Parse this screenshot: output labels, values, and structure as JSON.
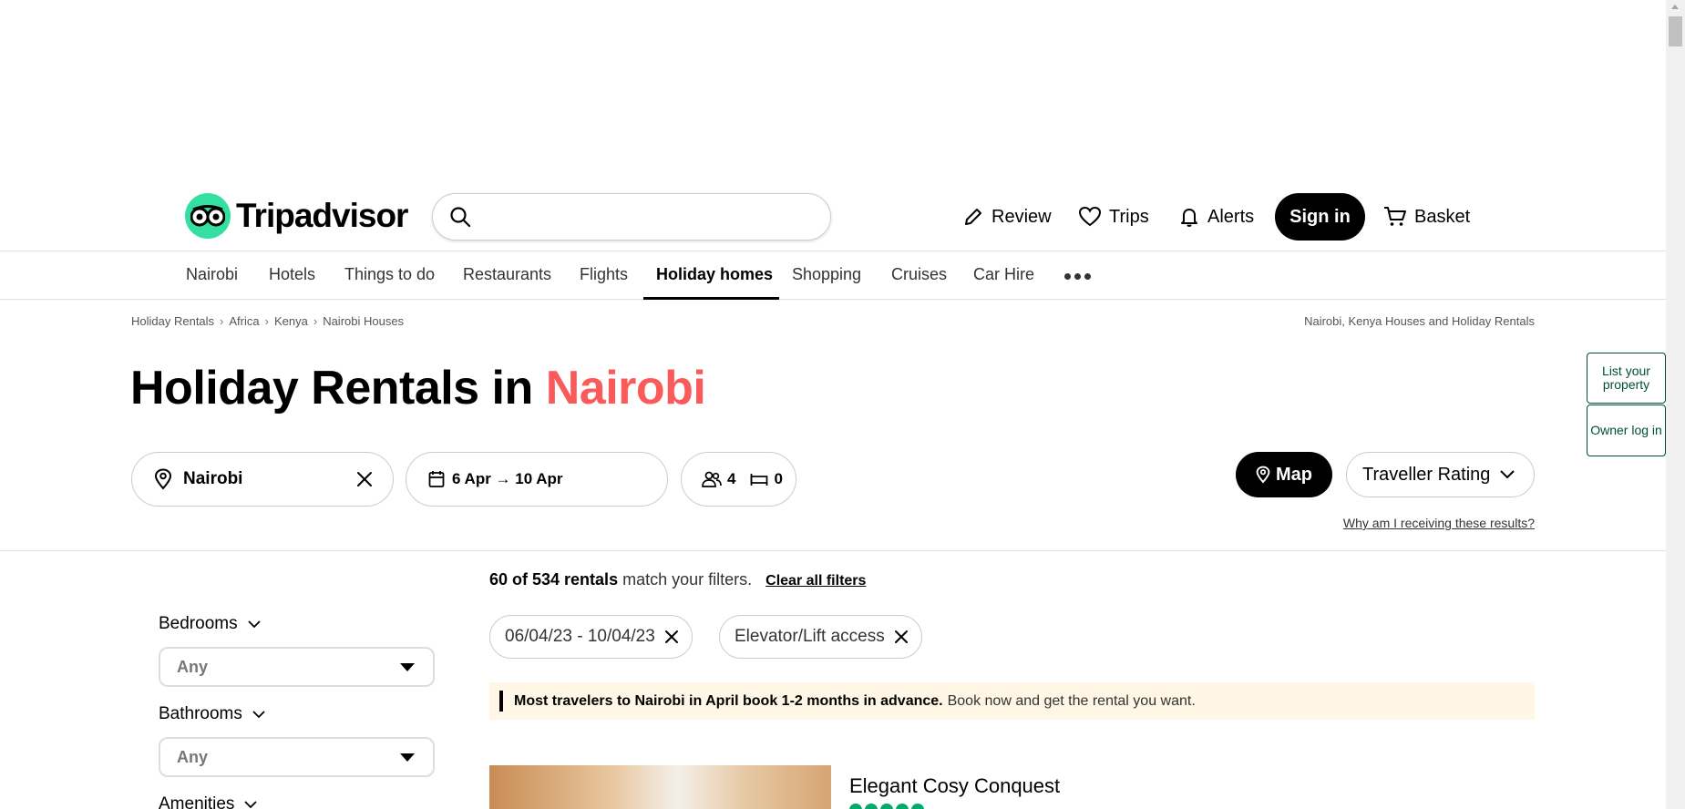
{
  "header": {
    "logo_text": "Tripadvisor",
    "search_placeholder": "",
    "review": "Review",
    "trips": "Trips",
    "alerts": "Alerts",
    "signin": "Sign in",
    "basket": "Basket"
  },
  "nav": {
    "items": [
      "Nairobi",
      "Hotels",
      "Things to do",
      "Restaurants",
      "Flights",
      "Holiday homes",
      "Shopping",
      "Cruises",
      "Car Hire"
    ],
    "active": "Holiday homes"
  },
  "breadcrumb": {
    "items": [
      "Holiday Rentals",
      "Africa",
      "Kenya",
      "Nairobi Houses"
    ],
    "right": "Nairobi, Kenya Houses and Holiday Rentals"
  },
  "side": {
    "list_property": "List your property",
    "owner_login": "Owner log in"
  },
  "title": {
    "prefix": "Holiday Rentals in ",
    "city": "Nairobi"
  },
  "filters": {
    "location": "Nairobi",
    "dates": "6 Apr → 10 Apr",
    "guests": "4",
    "bedrooms_count": "0",
    "map": "Map",
    "sort": "Traveller Rating",
    "why": "Why am I receiving these results?"
  },
  "sidebar": {
    "bedrooms_label": "Bedrooms",
    "bedrooms_value": "Any",
    "bathrooms_label": "Bathrooms",
    "bathrooms_value": "Any",
    "amenities_label": "Amenities"
  },
  "results": {
    "count_bold": "60 of 534 rentals",
    "count_rest": " match your filters.",
    "clear": "Clear all filters",
    "chips": [
      "06/04/23 - 10/04/23",
      "Elevator/Lift access"
    ],
    "notice_bold": "Most travelers to Nairobi in April book 1-2 months in advance.",
    "notice_rest": "Book now and get the rental you want.",
    "listing_title": "Elegant Cosy Conquest",
    "listing_rating": 5
  },
  "colors": {
    "accent": "#fa5a5a",
    "brand_green": "#34e0a1",
    "dark_green": "#004f32",
    "rating_green": "#00aa6c"
  }
}
